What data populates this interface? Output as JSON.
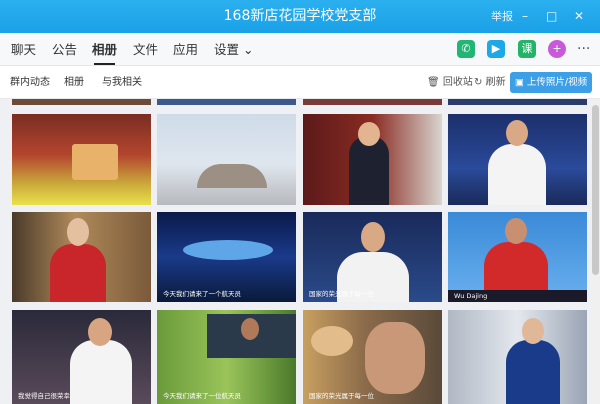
{
  "window": {
    "title": "168新店花园学校党支部",
    "report": "举报",
    "minimize": "–",
    "maximize": "□",
    "close": "✕"
  },
  "tabs": [
    "聊天",
    "公告",
    "相册",
    "文件",
    "应用",
    "设置 ⌄"
  ],
  "subnav": [
    "群内动态",
    "相册",
    "与我相关"
  ],
  "actions": {
    "recycle": "回收站",
    "refresh": "刷新",
    "upload": "上传照片/视频"
  },
  "photos": [
    {
      "caption": "今天我们请来了一个航天员"
    },
    {
      "caption": "国家的荣光属于每一位"
    },
    {
      "caption": "我觉得自己很荣幸"
    },
    {
      "caption": ""
    },
    {
      "caption": "今天我们请来了一位航天员"
    },
    {
      "caption": "国家的荣光属于每一位"
    },
    {
      "caption": "Wu Dajing"
    },
    {
      "caption": ""
    }
  ],
  "colors": {
    "titlebar": "#1aa0e6",
    "accent": "#3d9fe6"
  }
}
